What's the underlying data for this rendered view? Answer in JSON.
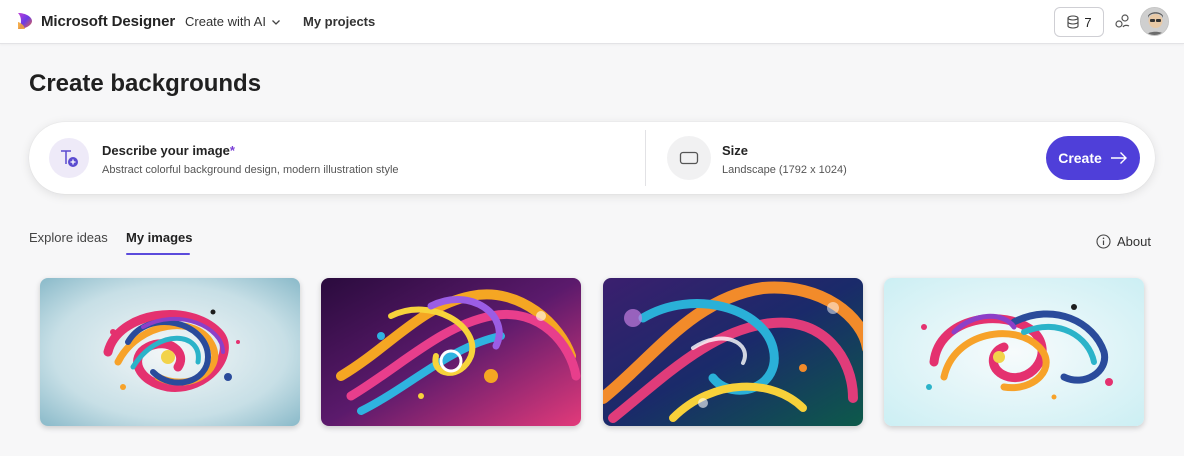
{
  "header": {
    "brand": "Microsoft Designer",
    "nav_create": "Create with AI",
    "nav_projects": "My projects",
    "credits": "7"
  },
  "page": {
    "title": "Create backgrounds"
  },
  "prompt": {
    "label": "Describe your image",
    "required_mark": "*",
    "value": "Abstract colorful background design, modern illustration style"
  },
  "size": {
    "label": "Size",
    "value": "Landscape (1792 x 1024)"
  },
  "create_button": "Create",
  "tabs": [
    {
      "label": "Explore ideas",
      "active": false
    },
    {
      "label": "My images",
      "active": true
    }
  ],
  "about": "About",
  "images": [
    {
      "icon": "abstract-swirl-light-teal"
    },
    {
      "icon": "abstract-swirl-dark-purple"
    },
    {
      "icon": "abstract-swirl-dark-blue"
    },
    {
      "icon": "abstract-swirl-pale-cyan"
    }
  ],
  "colors": {
    "accent": "#4f3fd9",
    "tab_underline": "#5b4bdc",
    "required": "#7a3fd6"
  }
}
